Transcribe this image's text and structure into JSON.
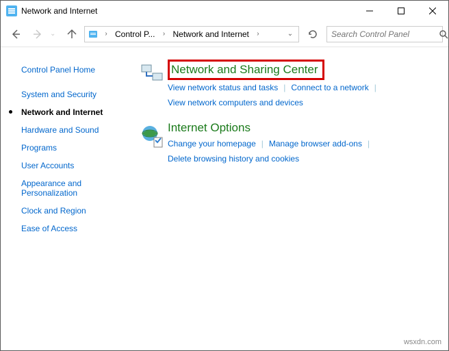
{
  "window": {
    "title": "Network and Internet"
  },
  "breadcrumb": {
    "item1": "Control P...",
    "item2": "Network and Internet"
  },
  "search": {
    "placeholder": "Search Control Panel"
  },
  "sidebar": {
    "home": "Control Panel Home",
    "items": [
      {
        "label": "System and Security"
      },
      {
        "label": "Network and Internet"
      },
      {
        "label": "Hardware and Sound"
      },
      {
        "label": "Programs"
      },
      {
        "label": "User Accounts"
      },
      {
        "label": "Appearance and Personalization"
      },
      {
        "label": "Clock and Region"
      },
      {
        "label": "Ease of Access"
      }
    ]
  },
  "content": {
    "sections": [
      {
        "title": "Network and Sharing Center",
        "links": [
          "View network status and tasks",
          "Connect to a network",
          "View network computers and devices"
        ]
      },
      {
        "title": "Internet Options",
        "links": [
          "Change your homepage",
          "Manage browser add-ons",
          "Delete browsing history and cookies"
        ]
      }
    ]
  },
  "watermark": "wsxdn.com"
}
